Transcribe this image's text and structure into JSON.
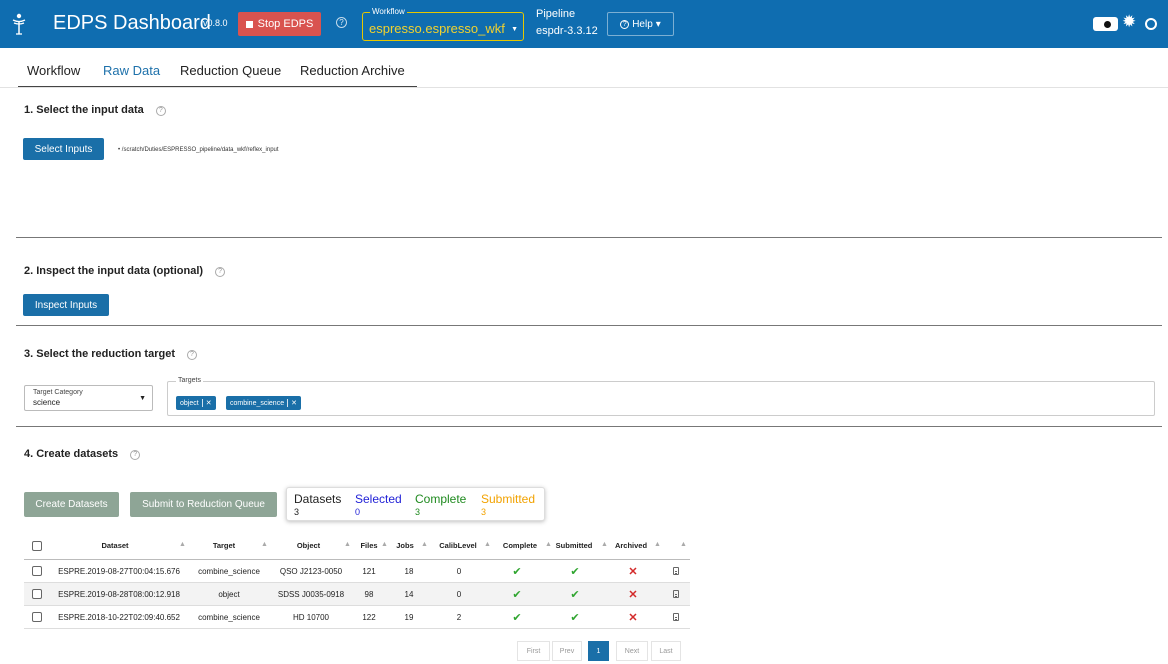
{
  "header": {
    "title": "EDPS Dashboard",
    "version": "v0.8.0",
    "stop_label": "Stop EDPS",
    "help_symbol": "?",
    "workflow_label": "Workflow",
    "workflow_value": "espresso.espresso_wkf",
    "pipeline_label": "Pipeline",
    "pipeline_value": "espdr-3.3.12",
    "help_label": "Help",
    "help_caret": "▾",
    "accent_color": "#0f6db0",
    "stop_color": "#d9534f",
    "workflow_value_color": "#f2d22e"
  },
  "tabs": [
    {
      "label": "Workflow"
    },
    {
      "label": "Raw Data",
      "active": true
    },
    {
      "label": "Reduction Queue"
    },
    {
      "label": "Reduction Archive"
    }
  ],
  "sections": {
    "s1": {
      "title": "1. Select the input data",
      "button": "Select Inputs",
      "path": "/scratch/Duties/ESPRESSO_pipeline/data_wkf/reflex_input"
    },
    "s2": {
      "title": "2. Inspect the input data (optional)",
      "button": "Inspect Inputs"
    },
    "s3": {
      "title": "3. Select the reduction target",
      "target_category_label": "Target Category",
      "target_category_value": "science",
      "targets_label": "Targets",
      "chips": [
        {
          "label": "object",
          "close": "✕"
        },
        {
          "label": "combine_science",
          "close": "✕"
        }
      ]
    },
    "s4": {
      "title": "4. Create datasets",
      "create_button": "Create Datasets",
      "submit_button": "Submit to Reduction Queue",
      "stats": [
        {
          "label": "Datasets",
          "value": "3",
          "color": "#222222"
        },
        {
          "label": "Selected",
          "value": "0",
          "color": "#1f1fd6"
        },
        {
          "label": "Complete",
          "value": "3",
          "color": "#1f8a1f"
        },
        {
          "label": "Submitted",
          "value": "3",
          "color": "#f2a200"
        }
      ]
    }
  },
  "table": {
    "columns": [
      "Dataset",
      "Target",
      "Object",
      "Files",
      "Jobs",
      "CalibLevel",
      "Complete",
      "Submitted",
      "Archived"
    ],
    "rows": [
      {
        "dataset": "ESPRE.2019-08-27T00:04:15.676",
        "target": "combine_science",
        "object": "QSO J2123-0050",
        "files": "121",
        "jobs": "18",
        "calib": "0",
        "complete": "✔",
        "submitted": "✔",
        "archived": "✕"
      },
      {
        "dataset": "ESPRE.2019-08-28T08:00:12.918",
        "target": "object",
        "object": "SDSS J0035-0918",
        "files": "98",
        "jobs": "14",
        "calib": "0",
        "complete": "✔",
        "submitted": "✔",
        "archived": "✕"
      },
      {
        "dataset": "ESPRE.2018-10-22T02:09:40.652",
        "target": "combine_science",
        "object": "HD 10700",
        "files": "122",
        "jobs": "19",
        "calib": "2",
        "complete": "✔",
        "submitted": "✔",
        "archived": "✕"
      }
    ],
    "sort_symbol": "▲"
  },
  "pagination": {
    "first": "First",
    "prev": "Prev",
    "current": "1",
    "next": "Next",
    "last": "Last"
  },
  "icons": {
    "theme_toggle": "toggle-icon",
    "light": "sun-icon",
    "dark": "moon-icon",
    "logo": "eso-logo-icon"
  }
}
